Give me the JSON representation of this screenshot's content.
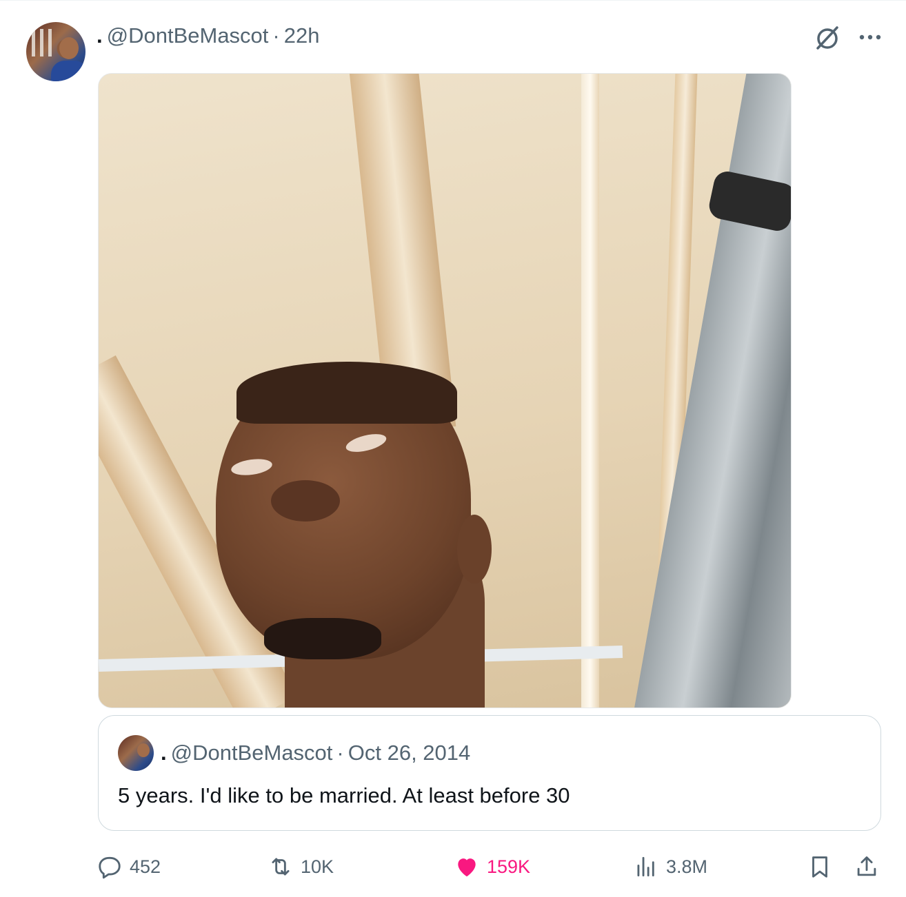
{
  "post": {
    "author_display": ".",
    "handle": "@DontBeMascot",
    "separator": "·",
    "time": "22h"
  },
  "quote": {
    "author_display": ".",
    "handle": "@DontBeMascot",
    "separator": "·",
    "date": "Oct 26, 2014",
    "text": "5 years. I'd like to be married. At least before 30"
  },
  "actions": {
    "replies": "452",
    "reposts": "10K",
    "likes": "159K",
    "views": "3.8M"
  },
  "colors": {
    "like_active": "#f91880",
    "muted_text": "#536471"
  },
  "icons": [
    "grok-icon",
    "more-icon",
    "reply-icon",
    "retweet-icon",
    "heart-icon",
    "views-icon",
    "bookmark-icon",
    "share-icon"
  ]
}
